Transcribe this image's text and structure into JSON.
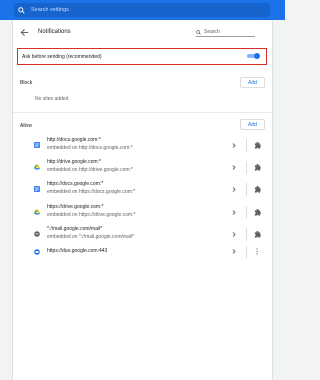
{
  "topbar": {
    "search_placeholder": "Search settings"
  },
  "page": {
    "title": "Notifications",
    "search_placeholder": "Search"
  },
  "ask": {
    "label": "Ask before sending (recommended)",
    "enabled": true
  },
  "block": {
    "label": "Block",
    "add_label": "Add",
    "empty_text": "No sites added"
  },
  "allow": {
    "label": "Allow",
    "add_label": "Add",
    "sites": [
      {
        "url": "http://docs.google.com:*",
        "sub": "embedded on http://docs.google.com:*",
        "icon": "docs-icon",
        "action_icon": "puzzle-icon"
      },
      {
        "url": "http://drive.google.com:*",
        "sub": "embedded on http://drive.google.com:*",
        "icon": "drive-icon",
        "action_icon": "puzzle-icon"
      },
      {
        "url": "https://docs.google.com:*",
        "sub": "embedded on https://docs.google.com:*",
        "icon": "docs-icon",
        "action_icon": "puzzle-icon"
      },
      {
        "url": "https://drive.google.com:*",
        "sub": "embedded on https://drive.google.com:*",
        "icon": "drive-icon",
        "action_icon": "puzzle-icon"
      },
      {
        "url": "*://mail.google.com/mail*",
        "sub": "embedded on *://mail.google.com/mail*",
        "icon": "mail-icon",
        "action_icon": "puzzle-icon"
      },
      {
        "url": "https://duo.google.com:443",
        "sub": "",
        "icon": "duo-icon",
        "action_icon": "more-vert-icon"
      }
    ]
  },
  "colors": {
    "accent": "#1a73e8",
    "highlight_border": "#d93025"
  }
}
